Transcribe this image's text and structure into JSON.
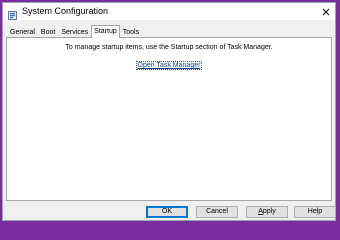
{
  "window": {
    "title": "System Configuration",
    "close_icon": "close-icon",
    "app_icon": "system-config-icon"
  },
  "tabs": [
    {
      "label": "General",
      "active": false
    },
    {
      "label": "Boot",
      "active": false
    },
    {
      "label": "Services",
      "active": false
    },
    {
      "label": "Startup",
      "active": true
    },
    {
      "label": "Tools",
      "active": false
    }
  ],
  "startup": {
    "message": "To manage startup items, use the Startup section of Task Manager.",
    "link_label": "Open Task Manager"
  },
  "buttons": {
    "ok": "OK",
    "cancel": "Cancel",
    "apply_mnemonic": "A",
    "apply_rest": "pply",
    "help": "Help"
  },
  "colors": {
    "desktop_border": "#7a2ea0",
    "link": "#0b3f8c",
    "default_button_border": "#0078d7"
  }
}
